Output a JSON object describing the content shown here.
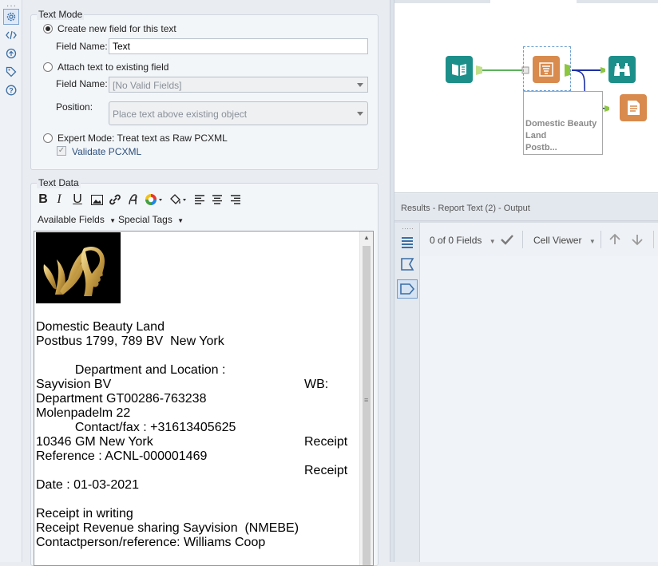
{
  "rail": {
    "icons": [
      "gear-icon",
      "code-icon",
      "workflow-icon",
      "tag-icon",
      "help-icon"
    ]
  },
  "text_mode": {
    "title": "Text Mode",
    "create_new_label": "Create new field for this text",
    "field_name_label": "Field Name:",
    "field_name_value": "Text",
    "attach_label": "Attach text to existing field",
    "attach_field_name_label": "Field Name:",
    "attach_field_value": "[No Valid Fields]",
    "position_label": "Position:",
    "position_value": "Place text above existing object",
    "expert_label": "Expert Mode: Treat text as Raw PCXML",
    "validate_label": "Validate PCXML"
  },
  "text_data": {
    "title": "Text Data",
    "available_fields": "Available Fields",
    "special_tags": "Special Tags",
    "toolbar": {
      "bold": "B",
      "italic": "I",
      "underline": "U"
    }
  },
  "editor": {
    "lines": [
      "Domestic Beauty Land",
      "Postbus 1799, 789 BV  New York",
      "",
      "           Department and Location :",
      "Sayvision BV",
      "Department GT00286-763238",
      "Molenpadelm 22",
      "           Contact/fax : +31613405625",
      "10346 GM New York",
      "Reference : ACNL-000001469",
      "",
      "Date : 01-03-2021",
      "",
      "Receipt in writing",
      "Receipt Revenue sharing Sayvision  (NMEBE)",
      "Contactperson/reference: Williams Coop"
    ],
    "right_wb": "WB:",
    "right_receipt_1": "Receipt",
    "right_receipt_2": "Receipt"
  },
  "canvas": {
    "node_label_1": "Domestic Beauty",
    "node_label_2": "Land",
    "node_label_3": "Postb..."
  },
  "results": {
    "title": "Results - Report Text (2) - Output",
    "fields_count": "0 of 0 Fields",
    "cell_viewer": "Cell Viewer"
  },
  "colors": {
    "teal_tool": "#1d8f8a",
    "orange_tool": "#d98a4d",
    "connection_green": "#8dc63f",
    "connection_blue": "#1d2fa5"
  }
}
